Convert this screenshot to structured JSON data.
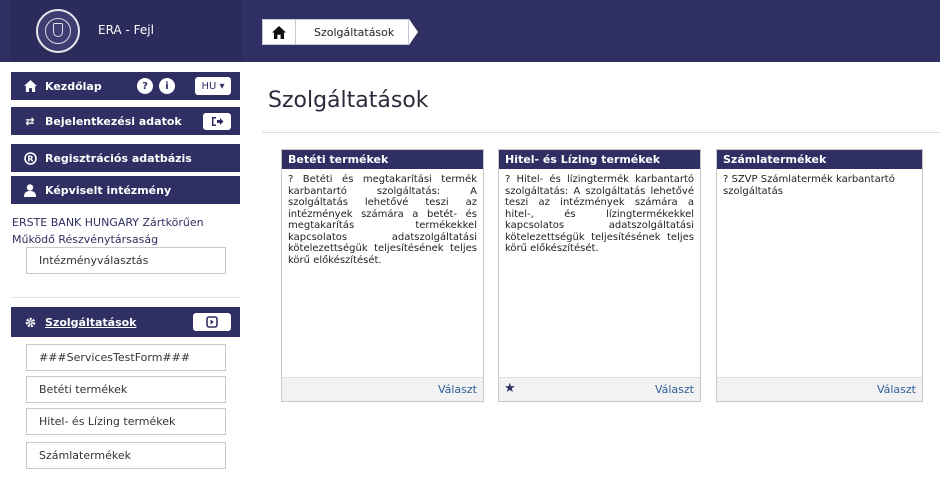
{
  "header": {
    "brand_title": "ERA - Fejl",
    "breadcrumb": "Szolgáltatások"
  },
  "sidebar": {
    "home_label": "Kezdőlap",
    "lang": "HU",
    "login_label": "Bejelentkezési adatok",
    "registry_label": "Regisztrációs adatbázis",
    "institution_label": "Képviselt intézmény",
    "institution_name_line1": "ERSTE BANK HUNGARY Zártkörűen",
    "institution_name_line2": "Működő Részvénytársaság",
    "institution_select": "Intézményválasztás",
    "services_label": "Szolgáltatások",
    "services": [
      "###ServicesTestForm###",
      "Betéti termékek",
      "Hitel- és Lízing termékek",
      "Számlatermékek"
    ]
  },
  "main": {
    "title": "Szolgáltatások",
    "cards": [
      {
        "title": "Betéti termékek",
        "body": "? Betéti és megtakarítási termék karbantartó szolgáltatás: A szolgáltatás lehetővé teszi az intézmények számára a betét- és megtakarítás termékekkel kapcsolatos adatszolgáltatási kötelezettségük teljesítésének teljes körű előkészítését.",
        "action": "Választ"
      },
      {
        "title": "Hitel- és Lízing termékek",
        "body": "? Hitel- és lízingtermék karbantartó szolgáltatás: A szolgáltatás lehetővé teszi az intézmények számára a hitel-, és lízingtermékekkel kapcsolatos adatszolgáltatási kötelezettségük teljesítésének teljes körű előkészítését.",
        "action": "Választ"
      },
      {
        "title": "Számlatermékek",
        "body": "? SZVP Számlatermék karbantartó szolgáltatás",
        "action": "Választ"
      }
    ]
  }
}
